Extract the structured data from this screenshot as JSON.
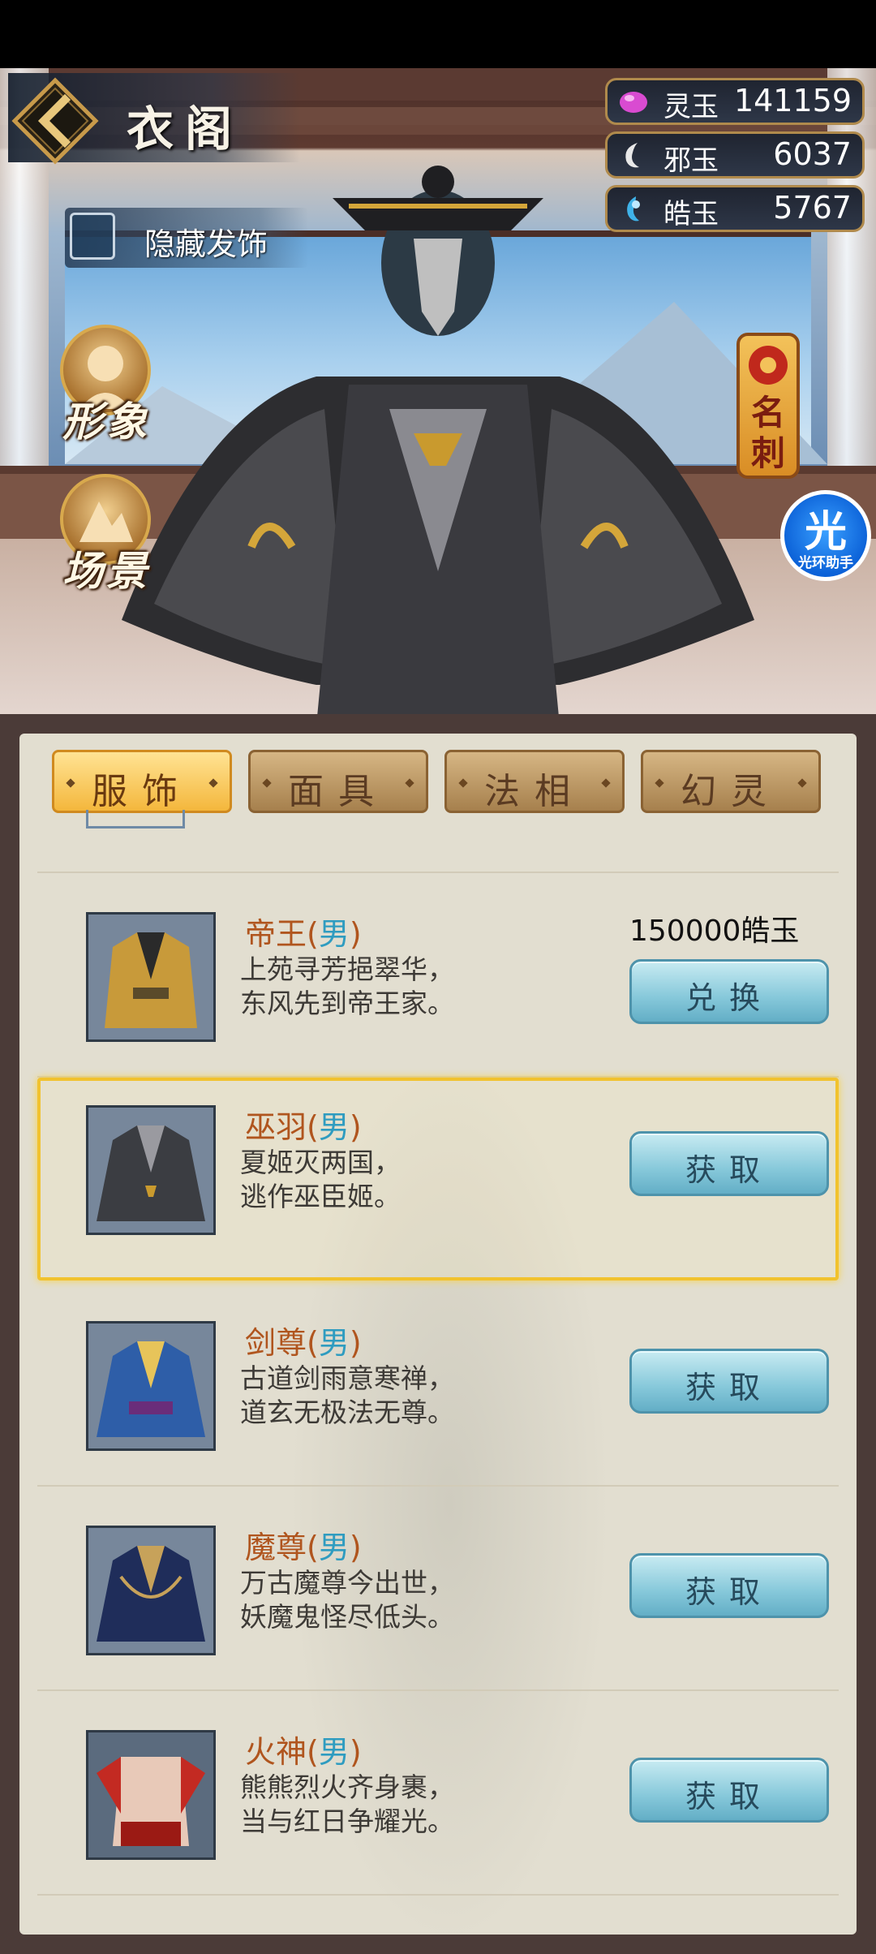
{
  "header": {
    "title": "衣阁"
  },
  "toggle": {
    "label": "隐藏发饰"
  },
  "side_buttons": [
    {
      "label": "形象",
      "icon": "portrait-icon"
    },
    {
      "label": "场景",
      "icon": "scenery-icon"
    }
  ],
  "currencies": [
    {
      "name": "灵玉",
      "value": "141159",
      "icon": "spirit-jade-icon",
      "color": "#d94bd1"
    },
    {
      "name": "邪玉",
      "value": "6037",
      "icon": "evil-jade-icon",
      "color": "#e8e8e8"
    },
    {
      "name": "皓玉",
      "value": "5767",
      "icon": "bright-jade-icon",
      "color": "#3fb2e8"
    }
  ],
  "famous_button": {
    "label": "名刺"
  },
  "helper": {
    "glyph": "光",
    "label": "光环助手"
  },
  "tabs": [
    {
      "label": "服饰",
      "active": true
    },
    {
      "label": "面具",
      "active": false
    },
    {
      "label": "法相",
      "active": false
    },
    {
      "label": "幻灵",
      "active": false
    }
  ],
  "items": [
    {
      "name": "帝王",
      "gender": "男",
      "desc": "上苑寻芳挹翠华，\n东风先到帝王家。",
      "price": "150000皓玉",
      "action": "兑换",
      "selected": false,
      "color": "#c89a3a"
    },
    {
      "name": "巫羽",
      "gender": "男",
      "desc": "夏姬灭两国，\n逃作巫臣姬。",
      "price": "",
      "action": "获取",
      "selected": true,
      "color": "#3b3d42"
    },
    {
      "name": "剑尊",
      "gender": "男",
      "desc": "古道剑雨意寒禅，\n道玄无极法无尊。",
      "price": "",
      "action": "获取",
      "selected": false,
      "color": "#2e5ea8"
    },
    {
      "name": "魔尊",
      "gender": "男",
      "desc": "万古魔尊今出世，\n妖魔鬼怪尽低头。",
      "price": "",
      "action": "获取",
      "selected": false,
      "color": "#1f2d5a"
    },
    {
      "name": "火神",
      "gender": "男",
      "desc": "熊熊烈火齐身裹，\n当与红日争耀光。",
      "price": "",
      "action": "获取",
      "selected": false,
      "color": "#c32a22"
    }
  ]
}
